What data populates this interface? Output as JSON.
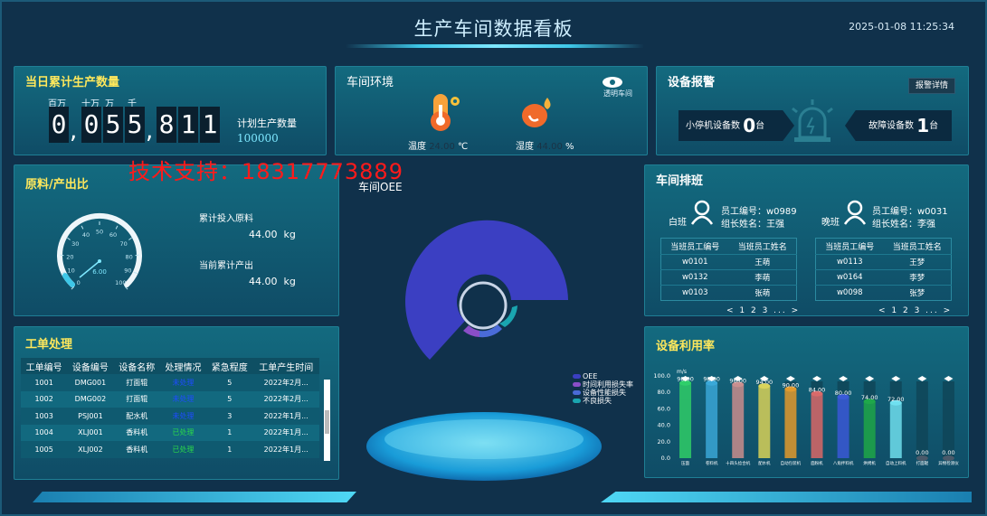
{
  "header": {
    "title": "生产车间数据看板",
    "datetime": "2025-01-08 11:25:34"
  },
  "watermark": "技术支持：18317773889",
  "production": {
    "title": "当日累计生产数量",
    "units": [
      "百万",
      "十万",
      "万",
      "千"
    ],
    "digits": [
      "0",
      "0",
      "5",
      "5",
      "8",
      "1",
      "1"
    ],
    "plan_label": "计划生产数量",
    "plan_value": "100000"
  },
  "env": {
    "title": "车间环境",
    "eye_label": "透明车间",
    "temp_label": "温度",
    "temp_value": "24.00",
    "temp_unit": "℃",
    "humid_label": "湿度",
    "humid_value": "44.00",
    "humid_unit": "%"
  },
  "alarm": {
    "title": "设备报警",
    "detail_btn": "报警详情",
    "stop_label": "小停机设备数",
    "stop_value": "0",
    "stop_unit": "台",
    "fault_label": "故障设备数",
    "fault_value": "1",
    "fault_unit": "台"
  },
  "ratio": {
    "title": "原料/产出比",
    "gauge_value": "6.00",
    "gauge_ticks": [
      "0",
      "10",
      "20",
      "30",
      "40",
      "50",
      "60",
      "70",
      "80",
      "90",
      "100"
    ],
    "input_label": "累计投入原料",
    "input_value": "44.00",
    "input_unit": "kg",
    "output_label": "当前累计产出",
    "output_value": "44.00",
    "output_unit": "kg"
  },
  "oee": {
    "title": "车间OEE",
    "legend": [
      "OEE",
      "时间利用损失率",
      "设备性能损失",
      "不良损失"
    ]
  },
  "workorder": {
    "title": "工单处理",
    "headers": [
      "工单编号",
      "设备编号",
      "设备名称",
      "处理情况",
      "紧急程度",
      "工单产生时间"
    ],
    "rows": [
      [
        "1001",
        "DMG001",
        "打面辊",
        "未处理",
        "5",
        "2022年2月..."
      ],
      [
        "1002",
        "DMG002",
        "打面辊",
        "未处理",
        "5",
        "2022年2月..."
      ],
      [
        "1003",
        "PSJ001",
        "配水机",
        "未处理",
        "3",
        "2022年1月..."
      ],
      [
        "1004",
        "XLJ001",
        "香料机",
        "已处理",
        "1",
        "2022年1月..."
      ],
      [
        "1005",
        "XLJ002",
        "香料机",
        "已处理",
        "1",
        "2022年1月..."
      ]
    ],
    "status_colors": {
      "未处理": "#1e4cff",
      "已处理": "#2bd94a"
    }
  },
  "shift": {
    "title": "车间排班",
    "day": {
      "name": "白班",
      "emp_no": "员工编号：w0989",
      "leader": "组长姓名：王强",
      "headers": [
        "当班员工编号",
        "当班员工姓名"
      ],
      "rows": [
        [
          "w0101",
          "王萌"
        ],
        [
          "w0132",
          "李萌"
        ],
        [
          "w0103",
          "张萌"
        ]
      ],
      "pager": "< 1 2 3 ... >"
    },
    "night": {
      "name": "晚班",
      "emp_no": "员工编号：w0031",
      "leader": "组长姓名：李强",
      "headers": [
        "当班员工编号",
        "当班员工姓名"
      ],
      "rows": [
        [
          "w0113",
          "王梦"
        ],
        [
          "w0164",
          "李梦"
        ],
        [
          "w0098",
          "张梦"
        ]
      ],
      "pager": "< 1 2 3 ... >"
    }
  },
  "chart_data": {
    "type": "bar",
    "title": "设备利用率",
    "ylabel": "m/s",
    "ylim": [
      0,
      100
    ],
    "yticks": [
      "100.0",
      "80.0",
      "60.0",
      "40.0",
      "20.0",
      "0.0"
    ],
    "categories": [
      "压面",
      "卷料机",
      "十四头捻合机",
      "配水机",
      "自动包装机",
      "面粉机",
      "八角拌料机",
      "烘烤机",
      "自动上料机",
      "打面辊",
      "异物检测仪"
    ],
    "values": [
      98,
      98,
      96,
      94,
      90,
      84,
      80,
      74,
      72,
      0,
      0
    ],
    "labels": [
      "98.00",
      "98.00",
      "96.00",
      "94.00",
      "90.00",
      "84.00",
      "80.00",
      "74.00",
      "72.00",
      "0.00",
      "0.00"
    ],
    "colors": [
      "#2fcf6a",
      "#3aa8d8",
      "#c98f8f",
      "#d8d35a",
      "#e09b2f",
      "#d96a6a",
      "#3a5bd8",
      "#1fa84a",
      "#6fe0f0",
      "#4a5a6a",
      "#4a5a6a"
    ]
  }
}
